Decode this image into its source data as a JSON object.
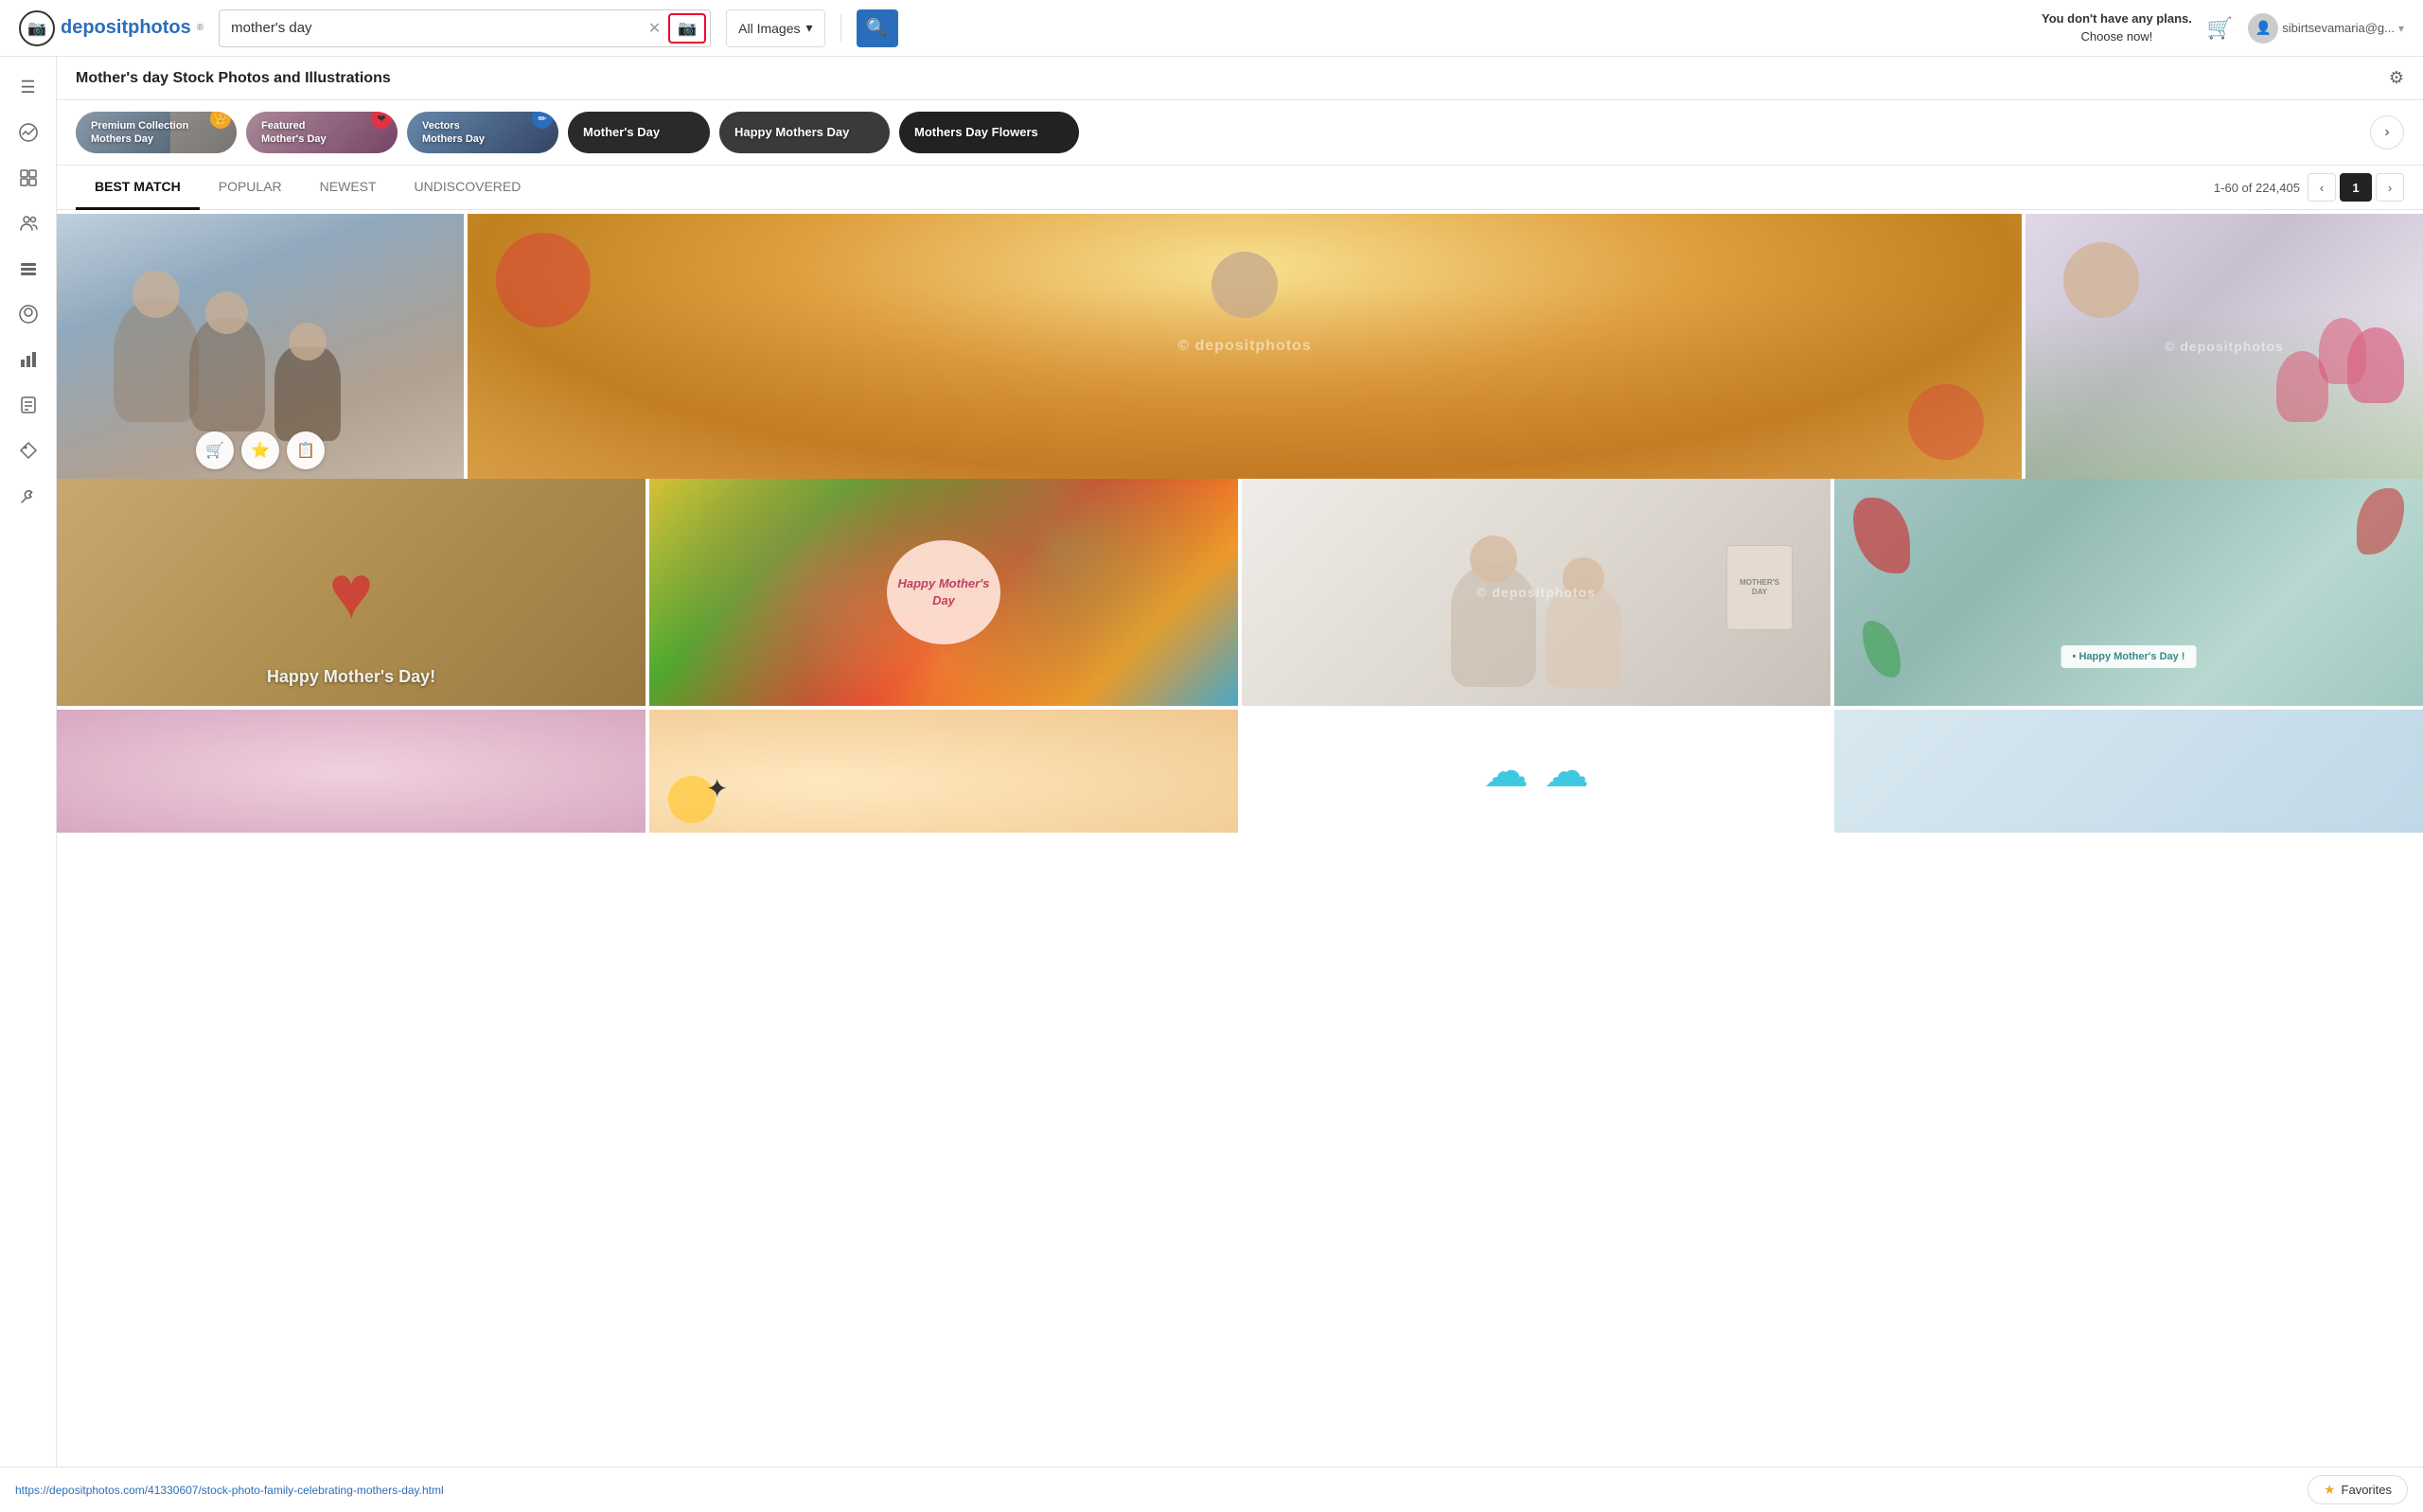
{
  "header": {
    "logo_text": "depositphotos",
    "search_value": "mother's day",
    "search_placeholder": "mother's day",
    "filter_label": "All Images",
    "plans_line1": "You don't have any plans.",
    "plans_line2": "Choose now!",
    "user_email": "sibirtsevamaria@g..."
  },
  "sidebar": {
    "items": [
      {
        "icon": "≡",
        "name": "menu"
      },
      {
        "icon": "📈",
        "name": "trending"
      },
      {
        "icon": "⊞",
        "name": "collections"
      },
      {
        "icon": "👥",
        "name": "people"
      },
      {
        "icon": "☰",
        "name": "list"
      },
      {
        "icon": "◎",
        "name": "circle"
      },
      {
        "icon": "↗",
        "name": "stats"
      },
      {
        "icon": "≡",
        "name": "doc"
      },
      {
        "icon": "🏷",
        "name": "tags"
      },
      {
        "icon": "🔧",
        "name": "tools"
      }
    ]
  },
  "page": {
    "title": "Mother's day Stock Photos and Illustrations",
    "categories": [
      {
        "label": "Premium Collection\nMothers Day",
        "badge": "👑",
        "badge_color": "#f5a623",
        "style": "chip1"
      },
      {
        "label": "Featured\nMother's Day",
        "badge": "❤️",
        "badge_color": "#e03",
        "style": "chip2"
      },
      {
        "label": "Vectors\nMothers Day",
        "badge": "✏️",
        "badge_color": "#2a6ebb",
        "style": "chip3"
      },
      {
        "label": "Mother's Day",
        "badge": "",
        "style": "chip4"
      },
      {
        "label": "Happy Mothers Day",
        "badge": "",
        "style": "chip5"
      },
      {
        "label": "Mothers Day Flowers",
        "badge": "",
        "style": "chip6"
      }
    ]
  },
  "tabs": [
    {
      "label": "BEST MATCH",
      "active": true
    },
    {
      "label": "POPULAR",
      "active": false
    },
    {
      "label": "NEWEST",
      "active": false
    },
    {
      "label": "UNDISCOVERED",
      "active": false
    }
  ],
  "pagination": {
    "range": "1-60 of 224,405",
    "current": "1"
  },
  "images": [
    {
      "label": "Family celebrating mothers day",
      "id": "row1-col1"
    },
    {
      "label": "",
      "id": "row1-col2"
    },
    {
      "label": "",
      "id": "row1-col3"
    },
    {
      "label": "",
      "id": "row2-col1"
    },
    {
      "label": "",
      "id": "row2-col2"
    },
    {
      "label": "Happy Mother's Day card",
      "id": "row2-col3"
    },
    {
      "label": "",
      "id": "row2-col4"
    },
    {
      "label": "",
      "id": "row3-col1"
    },
    {
      "label": "",
      "id": "row3-col2"
    }
  ],
  "bottom": {
    "url": "https://depositphotos.com/41330607/stock-photo-family-celebrating-mothers-day.html",
    "favorites_label": "Favorites"
  },
  "watermark": "© depositphotos",
  "action_buttons": {
    "cart": "🛒",
    "star": "⭐",
    "copy": "📋"
  },
  "happy_mothers_card_text": "Happy Mother's Day",
  "card_bottom_text": "Happy Mother's Day!"
}
